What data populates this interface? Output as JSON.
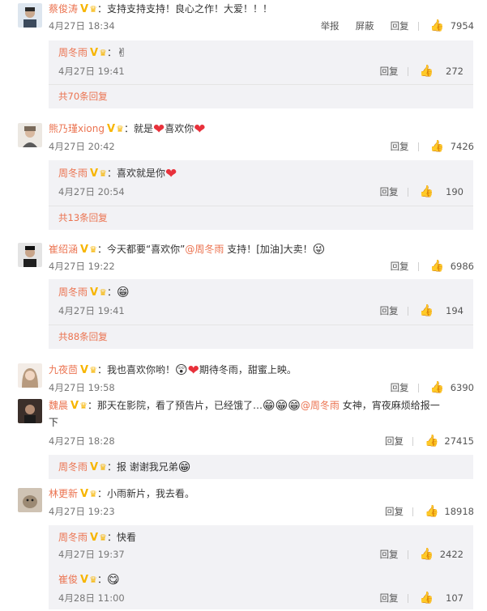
{
  "comments": [
    {
      "user": "蔡俊涛",
      "text": "：支持支持支持！良心之作！大爱！！！",
      "time": "4月27日 18:34",
      "actions": [
        "举报",
        "屏蔽",
        "回复"
      ],
      "likes": "7954",
      "reply": {
        "user": "周冬雨",
        "colon": "：",
        "emoji": "✌",
        "time": "4月27日 19:41",
        "reply_label": "回复",
        "likes": "272"
      },
      "more": "共70条回复"
    },
    {
      "user": "熊乃瑾xiong",
      "text_a": "：就是",
      "text_b": "喜欢你",
      "time": "4月27日 20:42",
      "reply_label": "回复",
      "likes": "7426",
      "reply": {
        "user": "周冬雨",
        "text": "：喜欢就是你",
        "time": "4月27日 20:54",
        "reply_label": "回复",
        "likes": "190"
      },
      "more": "共13条回复"
    },
    {
      "user": "崔绍涵",
      "text_a": "：今天都要“喜欢你”",
      "mention": "@周冬雨",
      "text_b": " 支持！[加油]大卖！",
      "time": "4月27日 19:22",
      "reply_label": "回复",
      "likes": "6986",
      "reply": {
        "user": "周冬雨",
        "colon": "：",
        "time": "4月27日 19:41",
        "reply_label": "回复",
        "likes": "194"
      },
      "more": "共88条回复"
    },
    {
      "user": "九夜茴",
      "text_a": "：我也喜欢你哟！",
      "text_b": "期待冬雨，甜蜜上映。",
      "time": "4月27日 19:58",
      "reply_label": "回复",
      "likes": "6390"
    },
    {
      "user": "魏晨",
      "text_a": "：那天在影院，看了预告片，已经饿了…",
      "mention": "@周冬雨",
      "text_b": " 女神，宵夜麻烦给报一",
      "text_c": "下",
      "time": "4月27日 18:28",
      "reply_label": "回复",
      "likes": "27415",
      "reply": {
        "user": "周冬雨",
        "text": "：报 谢谢我兄弟"
      }
    },
    {
      "user": "林更新",
      "text": "：小雨新片，我去看。",
      "time": "4月27日 19:23",
      "reply_label": "回复",
      "likes": "18918",
      "reply": {
        "user": "周冬雨",
        "text": "：快看",
        "time": "4月27日 19:37",
        "reply_label": "回复",
        "likes": "2422"
      },
      "reply2": {
        "user": "崔俊",
        "colon": "：",
        "time": "4月28日 11:00",
        "reply_label": "回复",
        "likes": "107"
      }
    }
  ],
  "badges": {
    "v": "V",
    "crown": "♛"
  },
  "icons": {
    "thumb": "thumb-up-icon"
  },
  "colors": {
    "username": "#eb7350",
    "badge": "#f7b500",
    "reply_bg": "#f2f2f5",
    "heart": "#e8313b"
  }
}
